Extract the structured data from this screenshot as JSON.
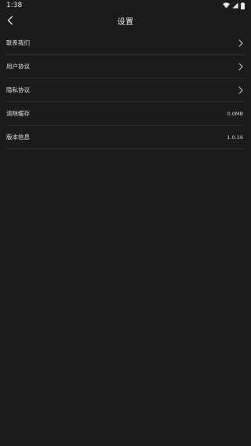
{
  "status_bar": {
    "time": "1:38"
  },
  "header": {
    "title": "设置"
  },
  "settings": {
    "items": [
      {
        "label": "联系我们",
        "type": "link"
      },
      {
        "label": "用户协议",
        "type": "link"
      },
      {
        "label": "隐私协议",
        "type": "link"
      },
      {
        "label": "清除缓存",
        "type": "value",
        "value": "0.0MB"
      },
      {
        "label": "版本信息",
        "type": "value",
        "value": "1.0.16"
      }
    ]
  },
  "icons": {
    "back": "chevron-left-icon",
    "row_arrow": "chevron-right-icon",
    "wifi": "wifi-icon",
    "signal": "cell-signal-icon",
    "battery": "battery-icon"
  },
  "colors": {
    "background": "#1b1b1b",
    "divider": "#2d2d2d",
    "text": "#e3e3e3"
  }
}
